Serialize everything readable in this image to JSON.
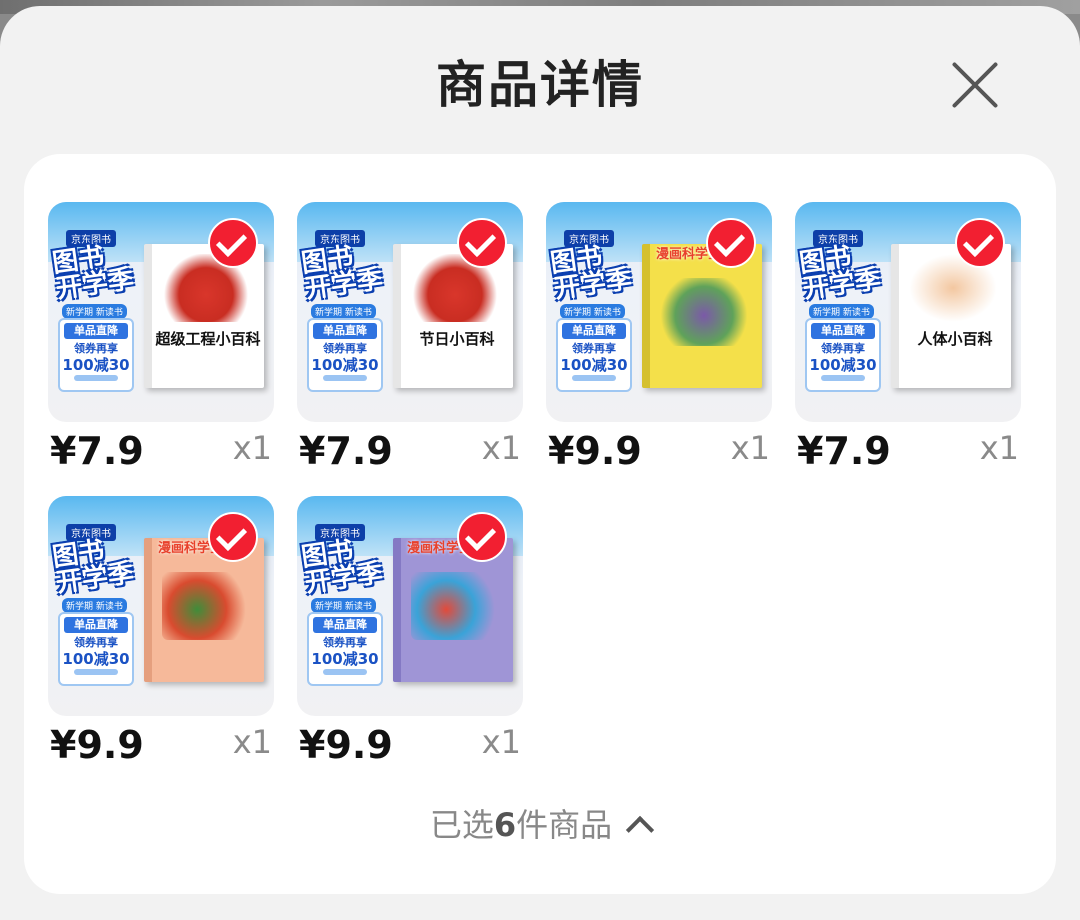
{
  "header": {
    "title": "商品详情",
    "close_icon": "close-icon"
  },
  "promo": {
    "tag": "京东图书",
    "big_line1": "图书",
    "big_line2": "开学季",
    "sub": "新学期 新读书",
    "line1": "单品直降",
    "line2": "领券再享",
    "line3": "100减30"
  },
  "items": [
    {
      "price": "¥7.9",
      "qty": "x1",
      "book_title": "超级工程小百科",
      "book_style": "white",
      "selected": true
    },
    {
      "price": "¥7.9",
      "qty": "x1",
      "book_title": "节日小百科",
      "book_style": "white",
      "selected": true
    },
    {
      "price": "¥9.9",
      "qty": "x1",
      "book_title": "漫画科学全知道",
      "book_style": "yellow",
      "selected": true
    },
    {
      "price": "¥7.9",
      "qty": "x1",
      "book_title": "人体小百科",
      "book_style": "white",
      "selected": true
    },
    {
      "price": "¥9.9",
      "qty": "x1",
      "book_title": "漫画科学全知道",
      "book_style": "peach",
      "selected": true
    },
    {
      "price": "¥9.9",
      "qty": "x1",
      "book_title": "漫画科学全知道",
      "book_style": "purple",
      "selected": true
    }
  ],
  "summary": {
    "prefix": "已选",
    "count": "6",
    "suffix": "件商品",
    "chevron_icon": "chevron-up-icon"
  },
  "colors": {
    "accent_red": "#f21f31",
    "sheet_bg": "#f2f2f2",
    "card_bg": "#ffffff",
    "text_dark": "#111111",
    "text_muted": "#8a8a8a"
  }
}
